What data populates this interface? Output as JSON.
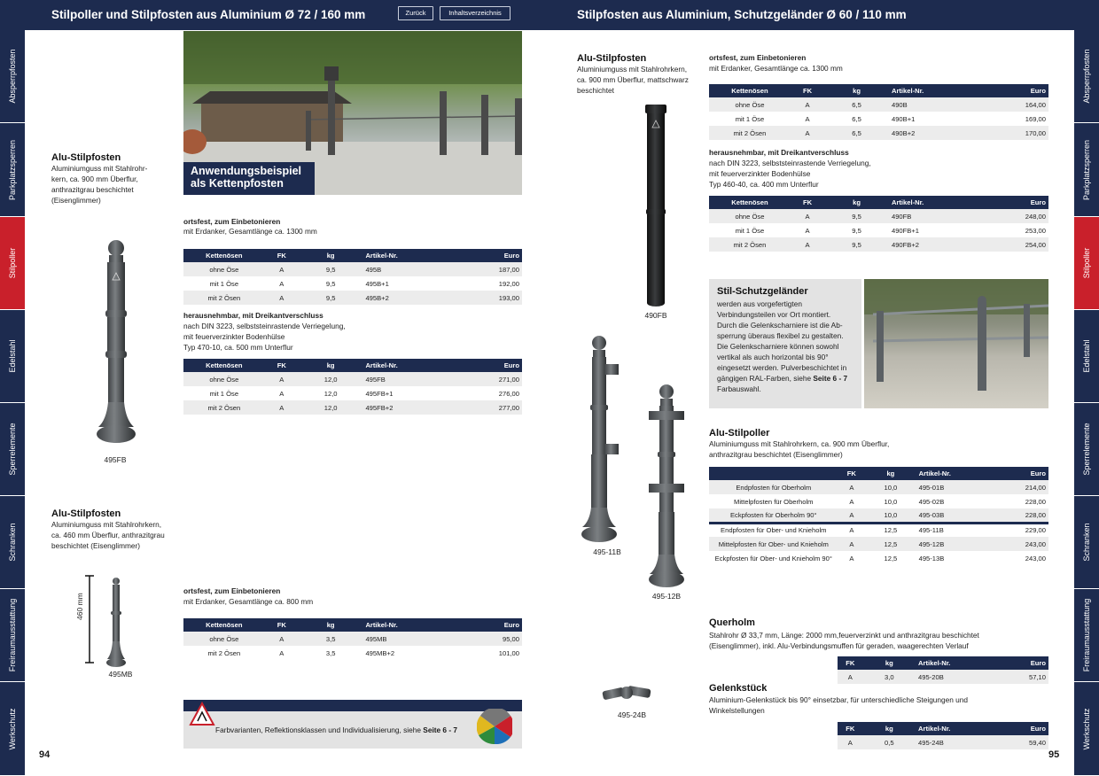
{
  "left_title": "Stilpoller und Stilpfosten aus Aluminium Ø 72 / 160 mm",
  "right_title": "Stilpfosten aus Aluminium, Schutzgeländer Ø 60 / 110 mm",
  "nav": {
    "back": "Zurück",
    "toc": "Inhaltsverzeichnis"
  },
  "tabs": [
    "Absperrpfosten",
    "Parkplatzsperren",
    "Stilpoller",
    "Edelstahl",
    "Sperrelemente",
    "Schranken",
    "Freiraumausstattung",
    "Werkschutz"
  ],
  "page_left": "94",
  "page_right": "95",
  "photo_caption": "Anwendungsbeispiel als Kettenpfosten",
  "p1": {
    "title": "Alu-Stilpfosten",
    "desc": "Aluminiumguss mit Stahlrohr-\nkern, ca. 900 mm Überflur,\nanthrazitgrau beschichtet\n(Eisenglimmer)",
    "label": "495FB"
  },
  "p2": {
    "title": "Alu-Stilpfosten",
    "desc": "Aluminiumguss mit Stahlrohrkern,\nca. 460 mm Überflur, anthrazitgrau\nbeschichtet (Eisenglimmer)",
    "label": "495MB",
    "dim": "460 mm"
  },
  "s1": {
    "head": "ortsfest, zum Einbetonieren",
    "sub": "mit Erdanker, Gesamtlänge ca. 1300 mm"
  },
  "s2": {
    "head": "herausnehmbar, mit Dreikantverschluss",
    "sub": "nach DIN 3223, selbststeinrastende Verriegelung,\nmit feuerverzinkter Bodenhülse\nTyp 470-10, ca. 500 mm Unterflur"
  },
  "s3": {
    "head": "ortsfest, zum Einbetonieren",
    "sub": "mit Erdanker, Gesamtlänge ca. 800 mm"
  },
  "cols": [
    "Kettenösen",
    "FK",
    "kg",
    "Artikel-Nr.",
    "Euro"
  ],
  "t1": [
    [
      "ohne Öse",
      "A",
      "9,5",
      "495B",
      "187,00"
    ],
    [
      "mit 1 Öse",
      "A",
      "9,5",
      "495B+1",
      "192,00"
    ],
    [
      "mit 2 Ösen",
      "A",
      "9,5",
      "495B+2",
      "193,00"
    ]
  ],
  "t2": [
    [
      "ohne Öse",
      "A",
      "12,0",
      "495FB",
      "271,00"
    ],
    [
      "mit 1 Öse",
      "A",
      "12,0",
      "495FB+1",
      "276,00"
    ],
    [
      "mit 2 Ösen",
      "A",
      "12,0",
      "495FB+2",
      "277,00"
    ]
  ],
  "t3": [
    [
      "ohne Öse",
      "A",
      "3,5",
      "495MB",
      "95,00"
    ],
    [
      "mit 2 Ösen",
      "A",
      "3,5",
      "495MB+2",
      "101,00"
    ]
  ],
  "footer": {
    "text": "Farbvarianten, Reflektionsklassen und Individualisierung, siehe ",
    "bold": "Seite 6 - 7"
  },
  "r1": {
    "title": "Alu-Stilpfosten",
    "desc": "Aluminiumguss mit Stahlrohrkern,\nca. 900 mm Überflur, mattschwarz\nbeschichtet",
    "label": "490FB"
  },
  "rs1": {
    "head": "ortsfest, zum Einbetonieren",
    "sub": "mit Erdanker, Gesamtlänge ca. 1300 mm"
  },
  "rs2": {
    "head": "herausnehmbar, mit Dreikantverschluss",
    "sub": "nach DIN 3223, selbststeinrastende Verriegelung,\nmit feuerverzinkter Bodenhülse\nTyp 460-40, ca. 400 mm Unterflur"
  },
  "rt1": [
    [
      "ohne Öse",
      "A",
      "6,5",
      "490B",
      "164,00"
    ],
    [
      "mit 1 Öse",
      "A",
      "6,5",
      "490B+1",
      "169,00"
    ],
    [
      "mit 2 Ösen",
      "A",
      "6,5",
      "490B+2",
      "170,00"
    ]
  ],
  "rt2": [
    [
      "ohne Öse",
      "A",
      "9,5",
      "490FB",
      "248,00"
    ],
    [
      "mit 1 Öse",
      "A",
      "9,5",
      "490FB+1",
      "253,00"
    ],
    [
      "mit 2 Ösen",
      "A",
      "9,5",
      "490FB+2",
      "254,00"
    ]
  ],
  "gel": {
    "title": "Stil-Schutzgeländer",
    "desc": "werden aus vorgefertigten\nVerbindungsteilen vor Ort montiert.\nDurch die Gelenkscharniere ist die Ab-\nsperrung überaus flexibel zu gestalten.\nDie Gelenkscharniere können sowohl\nvertikal als auch horizontal bis 90°\neingesetzt werden. Pulverbeschichtet in\ngängigen RAL-Farben, siehe ",
    "bold": "Seite 6 - 7",
    "tail": "Farbauswahl."
  },
  "poller": {
    "title": "Alu-Stilpoller",
    "desc": "Aluminiumguss mit Stahlrohrkern, ca. 900 mm Überflur,\nanthrazitgrau beschichtet (Eisenglimmer)"
  },
  "pcols": [
    "",
    "FK",
    "kg",
    "Artikel-Nr.",
    "Euro"
  ],
  "pt": [
    [
      "Endpfosten für Oberholm",
      "A",
      "10,0",
      "495-01B",
      "214,00"
    ],
    [
      "Mittelpfosten für Oberholm",
      "A",
      "10,0",
      "495-02B",
      "228,00"
    ],
    [
      "Eckpfosten für Oberholm 90°",
      "A",
      "10,0",
      "495-03B",
      "228,00"
    ],
    [
      "Endpfosten für Ober- und Knieholm",
      "A",
      "12,5",
      "495-11B",
      "229,00"
    ],
    [
      "Mittelpfosten für Ober- und Knieholm",
      "A",
      "12,5",
      "495-12B",
      "243,00"
    ],
    [
      "Eckpfosten für Ober- und Knieholm 90°",
      "A",
      "12,5",
      "495-13B",
      "243,00"
    ]
  ],
  "lbl11": "495-11B",
  "lbl12": "495-12B",
  "quer": {
    "title": "Querholm",
    "desc": "Stahlrohr Ø 33,7 mm, Länge: 2000 mm,feuerverzinkt und anthrazitgrau beschichtet\n(Eisenglimmer), inkl. Alu-Verbindungsmuffen für geraden, waagerechten Verlauf"
  },
  "qcols": [
    "FK",
    "kg",
    "Artikel-Nr.",
    "Euro"
  ],
  "qt": [
    [
      "A",
      "3,0",
      "495-20B",
      "57,10"
    ]
  ],
  "gs": {
    "title": "Gelenkstück",
    "desc": "Aluminium-Gelenkstück bis 90° einsetzbar, für unterschiedliche Steigungen und\nWinkelstellungen",
    "label": "495-24B"
  },
  "gt": [
    [
      "A",
      "0,5",
      "495-24B",
      "59,40"
    ]
  ],
  "colors": {
    "navy": "#1d2b4f",
    "red": "#c9202b"
  }
}
